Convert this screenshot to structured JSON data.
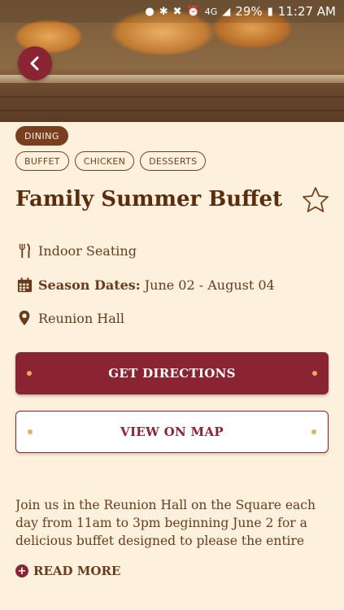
{
  "status_bar": {
    "battery": "29%",
    "time": "11:27 AM",
    "network": "4G"
  },
  "header": {
    "back_icon": "back-arrow-icon"
  },
  "tags": {
    "category": "DINING",
    "items": [
      "BUFFET",
      "CHICKEN",
      "DESSERTS"
    ]
  },
  "event": {
    "title": "Family Summer Buffet",
    "favorite_icon": "star-outline-icon",
    "seating": "Indoor Seating",
    "season_label": "Season Dates:",
    "season_value": "June 02 - August 04",
    "location": "Reunion Hall"
  },
  "actions": {
    "directions_label": "GET DIRECTIONS",
    "map_label": "VIEW ON MAP"
  },
  "description": {
    "text": "Join us in the Reunion Hall on the Square each day from 11am to 3pm beginning June 2 for a delicious buffet designed to please the entire fa...",
    "read_more_label": "READ MORE"
  },
  "colors": {
    "background": "#fdf0dc",
    "accent": "#8b2432",
    "brown": "#7a3f1f",
    "gold": "#e0b25c"
  }
}
